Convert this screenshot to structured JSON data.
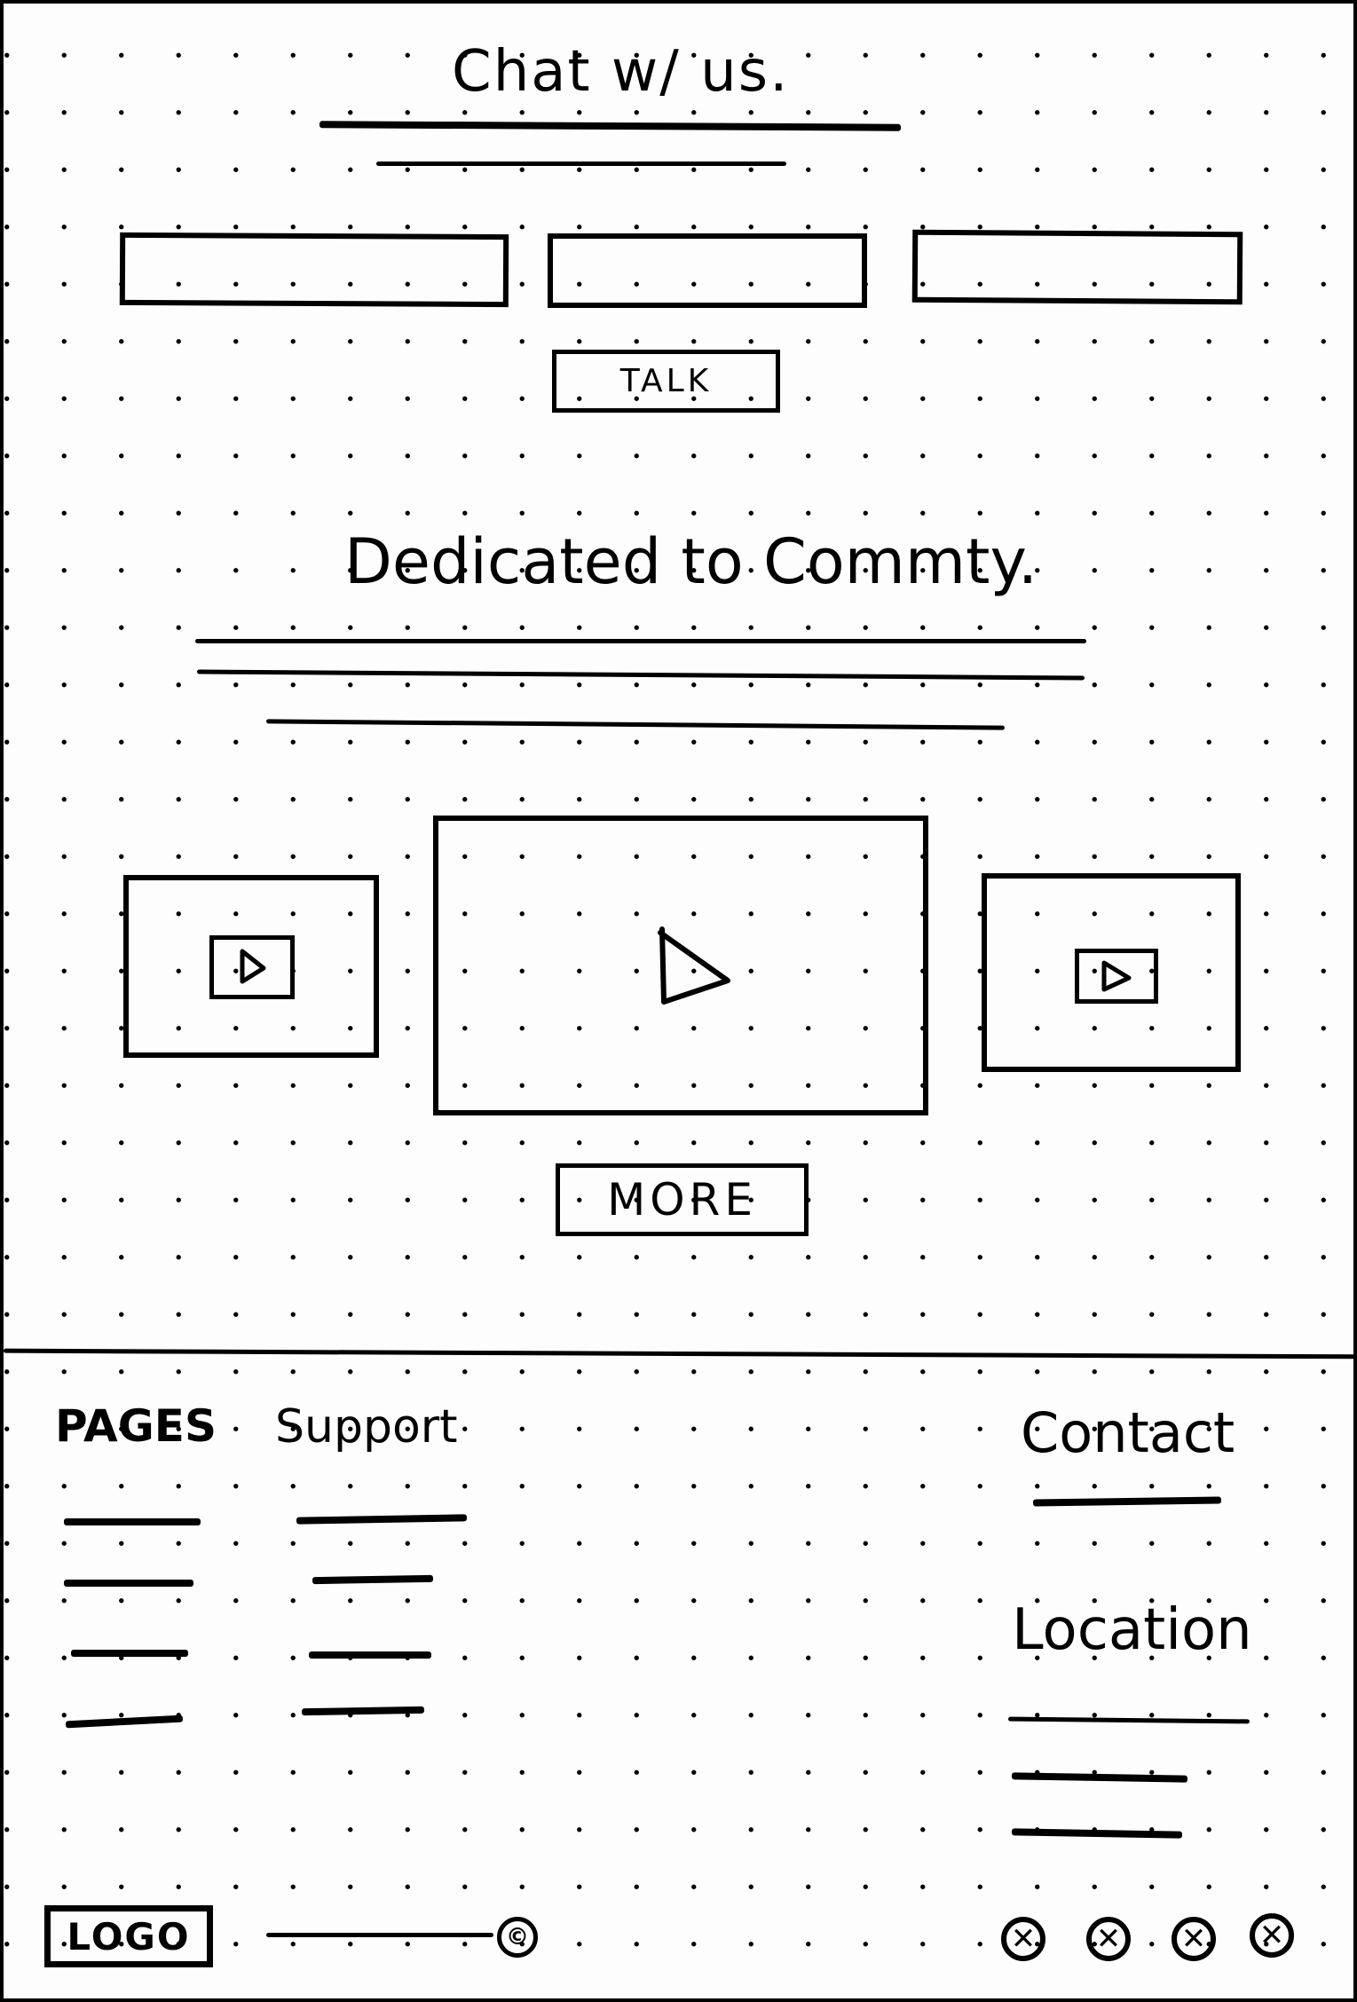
{
  "chat": {
    "title": "Chat w/ us.",
    "talk_button": "TALK"
  },
  "community": {
    "title": "Dedicated to Commty.",
    "more_button": "MORE"
  },
  "footer": {
    "pages_heading": "PAGES",
    "support_heading": "Support",
    "contact_heading": "Contact",
    "location_heading": "Location",
    "logo": "LOGO",
    "copyright_symbol": "©",
    "social_icons": [
      "social-icon",
      "social-icon",
      "social-icon",
      "social-icon"
    ]
  }
}
